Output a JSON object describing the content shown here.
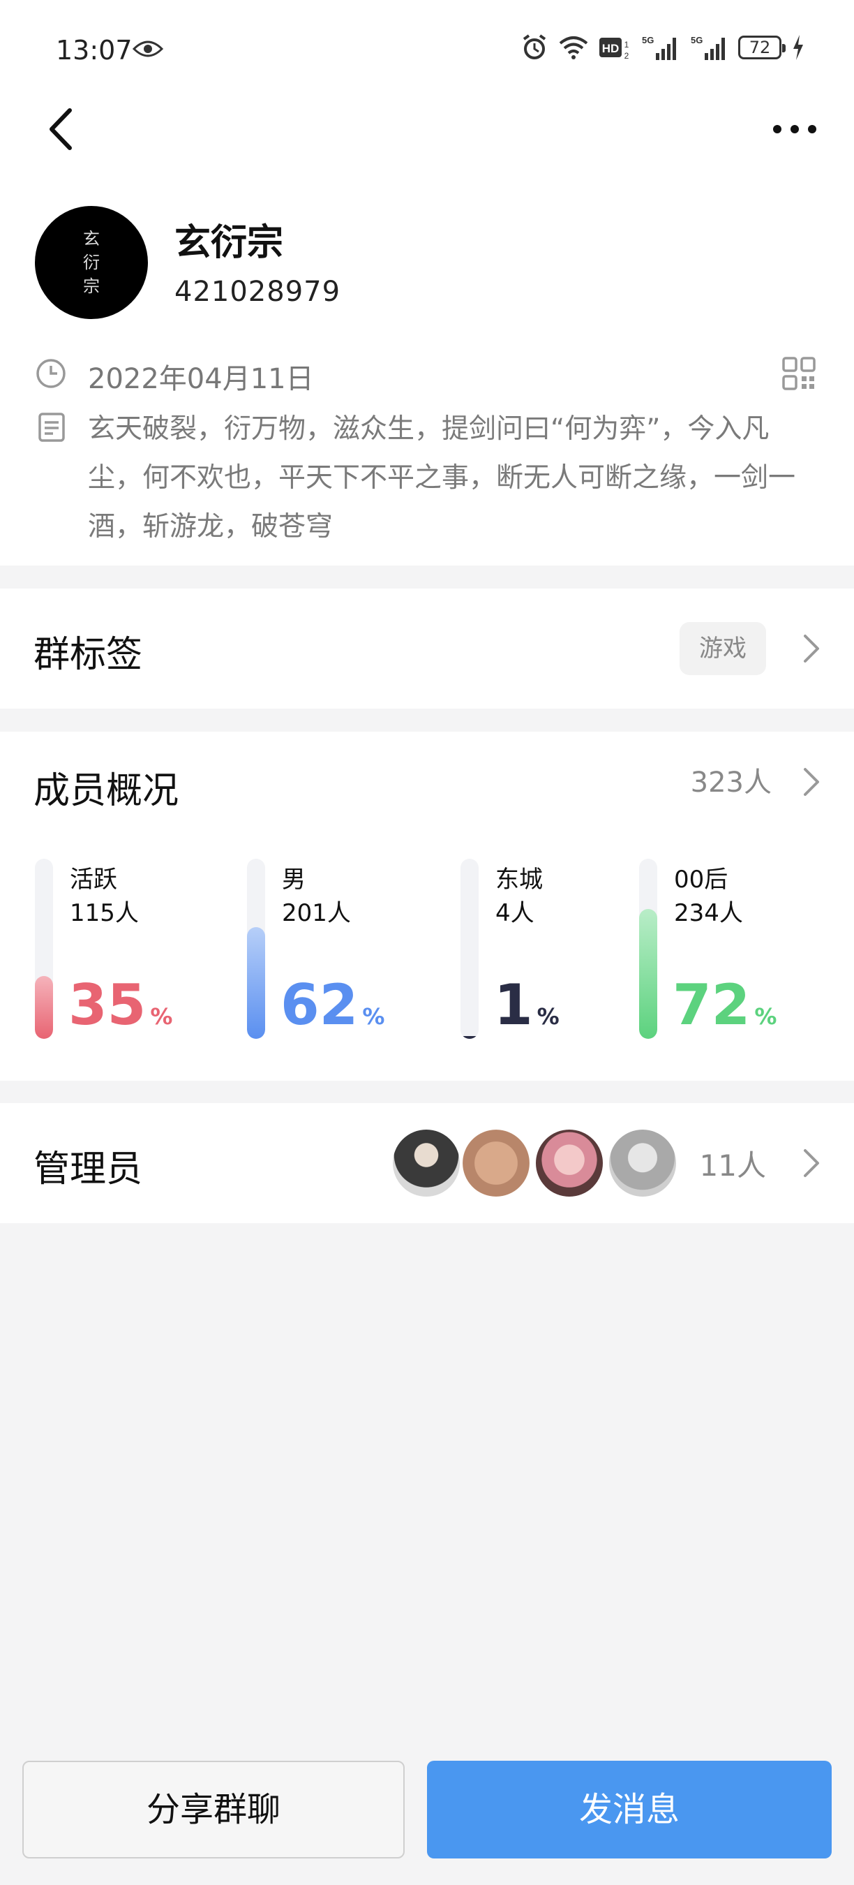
{
  "status_bar": {
    "time": "13:07",
    "battery": "72",
    "network_label_1": "5G",
    "network_label_2": "5G",
    "hd_label": "HD"
  },
  "group": {
    "avatar_text": [
      "玄",
      "衍",
      "宗"
    ],
    "name": "玄衍宗",
    "id": "421028979",
    "created_date": "2022年04月11日",
    "description": "玄天破裂，衍万物，滋众生，提剑问曰“何为弈”，今入凡尘，何不欢也，平天下不平之事，断无人可断之缘，一剑一酒，斩游龙，破苍穹"
  },
  "tags_section": {
    "title": "群标签",
    "tag": "游戏"
  },
  "members_section": {
    "title": "成员概况",
    "count": "323人",
    "stats": [
      {
        "label": "活跃",
        "count": "115人",
        "percent": "35",
        "unit": "%",
        "value": 0.35,
        "color": "#e86472",
        "color_light": "#f5b3bb"
      },
      {
        "label": "男",
        "count": "201人",
        "percent": "62",
        "unit": "%",
        "value": 0.62,
        "color": "#5a8ff0",
        "color_light": "#b7cff8"
      },
      {
        "label": "东城",
        "count": "4人",
        "percent": "1",
        "unit": "%",
        "value": 0.01,
        "color": "#2a2d45",
        "color_light": "#2a2d45"
      },
      {
        "label": "00后",
        "count": "234人",
        "percent": "72",
        "unit": "%",
        "value": 0.72,
        "color": "#5cd27e",
        "color_light": "#b9edc8"
      }
    ]
  },
  "admins_section": {
    "title": "管理员",
    "count": "11人"
  },
  "bottom": {
    "share_label": "分享群聊",
    "send_label": "发消息"
  },
  "colors": {
    "accent": "#4a97f0",
    "background": "#f4f4f5"
  }
}
